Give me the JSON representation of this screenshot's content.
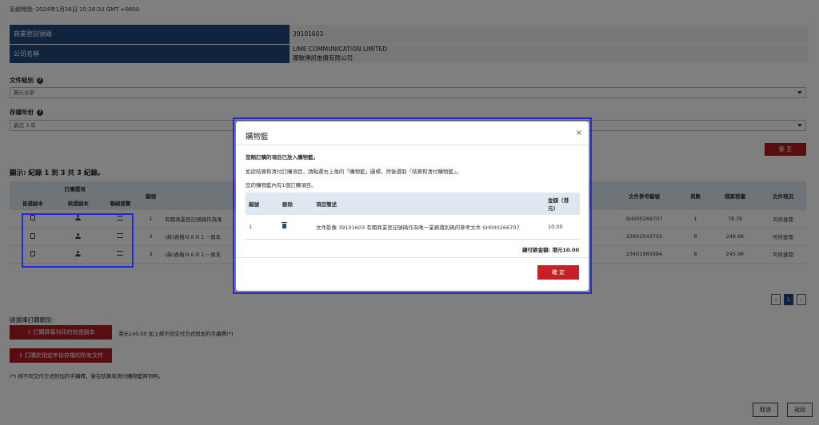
{
  "system_time": "系統時間:  2024年1月26日 15:26:20 GMT +0800",
  "company_info": {
    "reg_no_label": "商業登記號碼",
    "reg_no": "39101603",
    "name_label": "公司名稱",
    "name_en": "LIME COMMUNICATION LIMITED",
    "name_zh": "麗敏傳訊推廣有限公司"
  },
  "filters": {
    "doc_group_label": "文件組別",
    "doc_group_value": "顯示全部",
    "year_label": "存檔年份",
    "year_value": "最近 3 年",
    "go_button": "篩 至",
    "help_icon": "question-icon"
  },
  "results": {
    "display_text": "顯示: 紀錄 1 到 3 共 3 紀錄。",
    "group_header": "訂購選項",
    "columns": {
      "plain_copy": "普通副本",
      "certified_copy": "核證副本",
      "linked_view": "聯線閱覽",
      "number": "編號",
      "ref_no": "文件參考編號",
      "pages": "頁數",
      "size": "檔案容量",
      "status": "文件現況"
    },
    "rows": [
      {
        "num": "1",
        "desc": "有關商業登記號碼作為唯",
        "ref": "SH000266707",
        "pages": "1",
        "size": "78.7K",
        "status": "可供查閱"
      },
      {
        "num": "2",
        "desc": "(英)表格ＮＡＲ１－周年",
        "ref": "22802543702",
        "pages": "8",
        "size": "248.9K",
        "status": "可供查閱"
      },
      {
        "num": "3",
        "desc": "(英)表格ＮＡＲ１－周年",
        "ref": "23401985984",
        "pages": "8",
        "size": "245.9K",
        "status": "可供查閱"
      }
    ]
  },
  "pagination": {
    "prev": "‹",
    "current": "1",
    "next": "›"
  },
  "order_section": {
    "label": "請選擇訂購類別:",
    "screen_print_button": "訂購屏幕列印的核證副本",
    "screen_print_note": "港元140.00 加上按不同交付方式附加的手續費(*)",
    "all_docs_button": "訂購於指定年份存檔的所有文件",
    "footnote": "(*) 按不同交付方式附加的手續費，會在結算和清付購物籃時列明。"
  },
  "bottom_buttons": {
    "cancel": "取消",
    "back": "返回"
  },
  "modal": {
    "title": "購物籃",
    "close": "×",
    "message_bold": "您剛訂購的項目已放入購物籃。",
    "message_instructions": "如欲結算和清付訂購項目，請點選右上角的「購物籃」圖標，然後選取「結算和清付購物籃」。",
    "message_count": "您的購物籃內有1個訂購項目。",
    "table": {
      "col_number": "編號",
      "col_delete": "刪除",
      "col_desc": "項目簡述",
      "col_amount_line1": "金額（港",
      "col_amount_line2": "元)",
      "rows": [
        {
          "num": "1",
          "desc": "文件影像 39101603 有關商業登記號碼作為唯一業務識別碼的參考文件 SH000266707",
          "amount": "10.00"
        }
      ]
    },
    "total": "總付款金額: 港元10.00",
    "ok_button": "確 定"
  },
  "colors": {
    "header_blue": "#214a7a",
    "button_red": "#b11b22",
    "highlight_blue": "#1f2bd6"
  }
}
